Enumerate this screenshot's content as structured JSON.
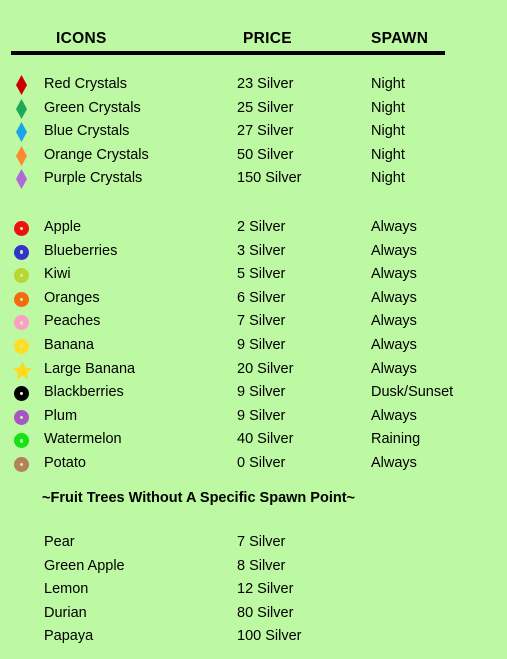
{
  "background_color": "#bdf8a3",
  "header": {
    "icons_label": "ICONS",
    "price_label": "PRICE",
    "spawn_label": "SPAWN"
  },
  "crystals": [
    {
      "icon": "red-crystal-icon",
      "icon_shape": "diamond",
      "icon_color": "#cc0000",
      "name": "Red Crystals",
      "price": "23 Silver",
      "spawn": "Night"
    },
    {
      "icon": "green-crystal-icon",
      "icon_shape": "diamond",
      "icon_color": "#1fa85a",
      "name": "Green Crystals",
      "price": "25 Silver",
      "spawn": "Night"
    },
    {
      "icon": "blue-crystal-icon",
      "icon_shape": "diamond",
      "icon_color": "#1ba3e8",
      "name": "Blue Crystals",
      "price": "27 Silver",
      "spawn": "Night"
    },
    {
      "icon": "orange-crystal-icon",
      "icon_shape": "diamond",
      "icon_color": "#ff8833",
      "name": "Orange Crystals",
      "price": "50 Silver",
      "spawn": "Night"
    },
    {
      "icon": "purple-crystal-icon",
      "icon_shape": "diamond",
      "icon_color": "#b06ad6",
      "name": "Purple Crystals",
      "price": "150 Silver",
      "spawn": "Night"
    }
  ],
  "fruits": [
    {
      "icon": "apple-icon",
      "icon_shape": "circle",
      "icon_color": "#ee1111",
      "name": "Apple",
      "price": "2 Silver",
      "spawn": "Always"
    },
    {
      "icon": "blueberries-icon",
      "icon_shape": "circle",
      "icon_color": "#3333cc",
      "name": "Blueberries",
      "price": "3 Silver",
      "spawn": "Always"
    },
    {
      "icon": "kiwi-icon",
      "icon_shape": "circle",
      "icon_color": "#bcd631",
      "name": "Kiwi",
      "price": "5 Silver",
      "spawn": "Always"
    },
    {
      "icon": "oranges-icon",
      "icon_shape": "circle",
      "icon_color": "#f56a0c",
      "name": "Oranges",
      "price": "6 Silver",
      "spawn": "Always"
    },
    {
      "icon": "peaches-icon",
      "icon_shape": "circle",
      "icon_color": "#ff9ec4",
      "name": "Peaches",
      "price": "7 Silver",
      "spawn": "Always"
    },
    {
      "icon": "banana-icon",
      "icon_shape": "circle",
      "icon_color": "#ffdd22",
      "name": "Banana",
      "price": "9 Silver",
      "spawn": "Always"
    },
    {
      "icon": "large-banana-icon",
      "icon_shape": "star",
      "icon_color": "#ffd91e",
      "name": "Large Banana",
      "price": "20 Silver",
      "spawn": "Always"
    },
    {
      "icon": "blackberries-icon",
      "icon_shape": "circle",
      "icon_color": "#000000",
      "name": "Blackberries",
      "price": "9 Silver",
      "spawn": "Dusk/Sunset"
    },
    {
      "icon": "plum-icon",
      "icon_shape": "circle",
      "icon_color": "#a855c6",
      "name": "Plum",
      "price": "9 Silver",
      "spawn": "Always"
    },
    {
      "icon": "watermelon-icon",
      "icon_shape": "circle",
      "icon_color": "#16e016",
      "name": "Watermelon",
      "price": "40 Silver",
      "spawn": "Raining"
    },
    {
      "icon": "potato-icon",
      "icon_shape": "circle",
      "icon_color": "#b5815c",
      "name": "Potato",
      "price": "0 Silver",
      "spawn": "Always"
    }
  ],
  "trees_subtitle": "~Fruit Trees Without A Specific Spawn Point~",
  "trees": [
    {
      "name": "Pear",
      "price": "7 Silver"
    },
    {
      "name": "Green Apple",
      "price": "8 Silver"
    },
    {
      "name": "Lemon",
      "price": "12 Silver"
    },
    {
      "name": "Durian",
      "price": "80 Silver"
    },
    {
      "name": "Papaya",
      "price": "100 Silver"
    }
  ]
}
